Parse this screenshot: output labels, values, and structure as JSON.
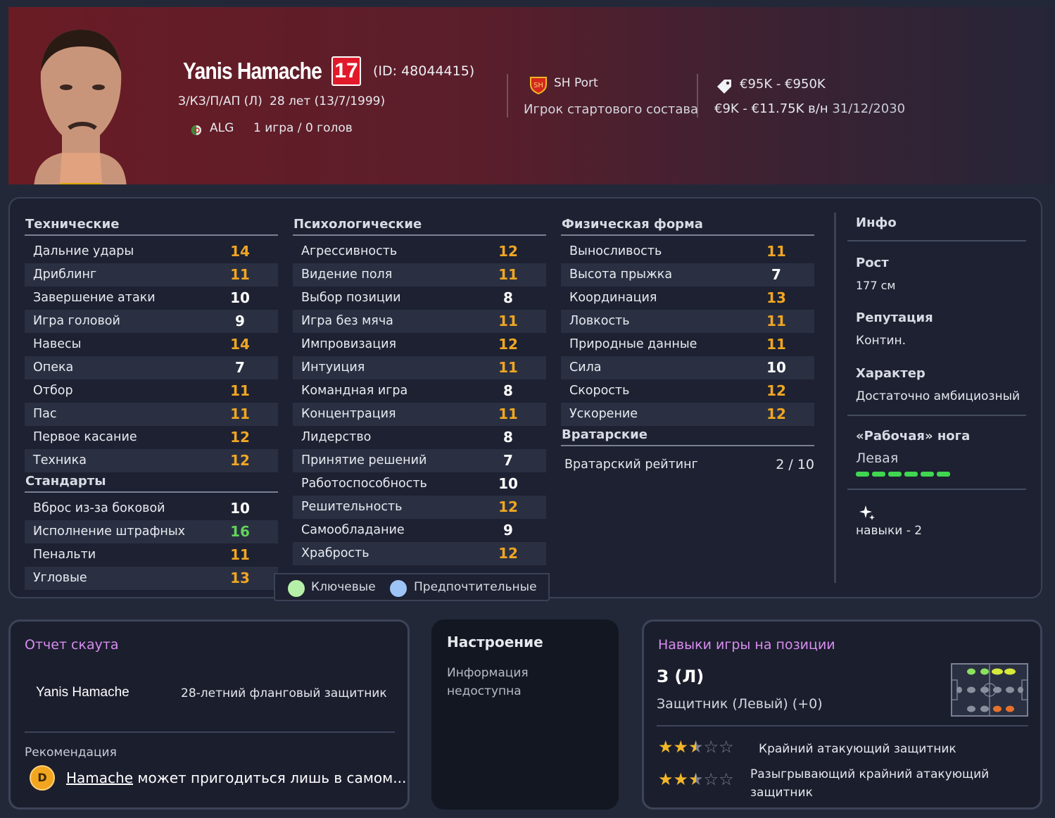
{
  "header": {
    "name": "Yanis Hamache",
    "number": "17",
    "id": "(ID: 48044415)",
    "positions": "З/КЗ/П/АП (Л)",
    "age": "28 лет (13/7/1999)",
    "nationality": "ALG",
    "caps": "1 игра / 0 голов",
    "club": "SH Port",
    "squad_role": "Игрок стартового состава",
    "value": "€95K - €950K",
    "wage": "€9K - €11.75K",
    "wage_unit": "в/н",
    "contract": "31/12/2030"
  },
  "technical": {
    "title": "Технические",
    "rows": [
      {
        "label": "Дальние удары",
        "value": "14",
        "color": "orange"
      },
      {
        "label": "Дриблинг",
        "value": "11",
        "color": "orange"
      },
      {
        "label": "Завершение атаки",
        "value": "10",
        "color": "white"
      },
      {
        "label": "Игра головой",
        "value": "9",
        "color": "white"
      },
      {
        "label": "Навесы",
        "value": "14",
        "color": "orange"
      },
      {
        "label": "Опека",
        "value": "7",
        "color": "white"
      },
      {
        "label": "Отбор",
        "value": "11",
        "color": "orange"
      },
      {
        "label": "Пас",
        "value": "11",
        "color": "orange"
      },
      {
        "label": "Первое касание",
        "value": "12",
        "color": "orange"
      },
      {
        "label": "Техника",
        "value": "12",
        "color": "orange"
      }
    ]
  },
  "setpieces": {
    "title": "Стандарты",
    "rows": [
      {
        "label": "Вброс из-за боковой",
        "value": "10",
        "color": "white"
      },
      {
        "label": "Исполнение штрафных",
        "value": "16",
        "color": "green"
      },
      {
        "label": "Пенальти",
        "value": "11",
        "color": "orange"
      },
      {
        "label": "Угловые",
        "value": "13",
        "color": "orange"
      }
    ]
  },
  "mental": {
    "title": "Психологические",
    "rows": [
      {
        "label": "Агрессивность",
        "value": "12",
        "color": "orange"
      },
      {
        "label": "Видение поля",
        "value": "11",
        "color": "orange"
      },
      {
        "label": "Выбор позиции",
        "value": "8",
        "color": "white"
      },
      {
        "label": "Игра без мяча",
        "value": "11",
        "color": "orange"
      },
      {
        "label": "Импровизация",
        "value": "12",
        "color": "orange"
      },
      {
        "label": "Интуиция",
        "value": "11",
        "color": "orange"
      },
      {
        "label": "Командная игра",
        "value": "8",
        "color": "white"
      },
      {
        "label": "Концентрация",
        "value": "11",
        "color": "orange"
      },
      {
        "label": "Лидерство",
        "value": "8",
        "color": "white"
      },
      {
        "label": "Принятие решений",
        "value": "7",
        "color": "white"
      },
      {
        "label": "Работоспособность",
        "value": "10",
        "color": "white"
      },
      {
        "label": "Решительность",
        "value": "12",
        "color": "orange"
      },
      {
        "label": "Самообладание",
        "value": "9",
        "color": "white"
      },
      {
        "label": "Храбрость",
        "value": "12",
        "color": "orange"
      }
    ]
  },
  "physical": {
    "title": "Физическая форма",
    "rows": [
      {
        "label": "Выносливость",
        "value": "11",
        "color": "orange"
      },
      {
        "label": "Высота прыжка",
        "value": "7",
        "color": "white"
      },
      {
        "label": "Координация",
        "value": "13",
        "color": "orange"
      },
      {
        "label": "Ловкость",
        "value": "11",
        "color": "orange"
      },
      {
        "label": "Природные данные",
        "value": "11",
        "color": "orange"
      },
      {
        "label": "Сила",
        "value": "10",
        "color": "white"
      },
      {
        "label": "Скорость",
        "value": "12",
        "color": "orange"
      },
      {
        "label": "Ускорение",
        "value": "12",
        "color": "orange"
      }
    ]
  },
  "goalkeeping": {
    "title": "Вратарские",
    "rating_label": "Вратарский рейтинг",
    "rating_value": "2 / 10"
  },
  "legend": {
    "key": "Ключевые",
    "preferred": "Предпочтительные",
    "key_color": "#b6f0a8",
    "preferred_color": "#9ec3f7"
  },
  "info": {
    "title": "Инфо",
    "height_label": "Рост",
    "height": "177 см",
    "reputation_label": "Репутация",
    "reputation": "Контин.",
    "personality_label": "Характер",
    "personality": "Достаточно амбициозный",
    "foot_label": "«Рабочая» нога",
    "foot": "Левая",
    "foot_level": 1.0,
    "traits": "навыки - 2"
  },
  "scout": {
    "title": "Отчет скаута",
    "name": "Yanis Hamache",
    "summary": "28-летний фланговый защитник",
    "rec_label": "Рекомендация",
    "grade": "D",
    "rec_name": "Hamache",
    "rec_text": " может пригодиться лишь в самом..."
  },
  "mood": {
    "title": "Настроение",
    "line1": "Информация",
    "line2": "недоступна"
  },
  "position": {
    "title": "Навыки игры на позиции",
    "code": "З (Л)",
    "desc": "Защитник (Левый) (+0)",
    "roles": [
      {
        "name": "Крайний атакующий защитник",
        "stars": 2.5
      },
      {
        "name": "Разыгрывающий крайний атакующий защитник",
        "stars": 2.5
      }
    ]
  },
  "colors": {
    "orange": "#f0a623",
    "white": "#ffffff",
    "green": "#63d35a",
    "accent_purple": "#d88df0",
    "number_red": "#e2192a"
  }
}
